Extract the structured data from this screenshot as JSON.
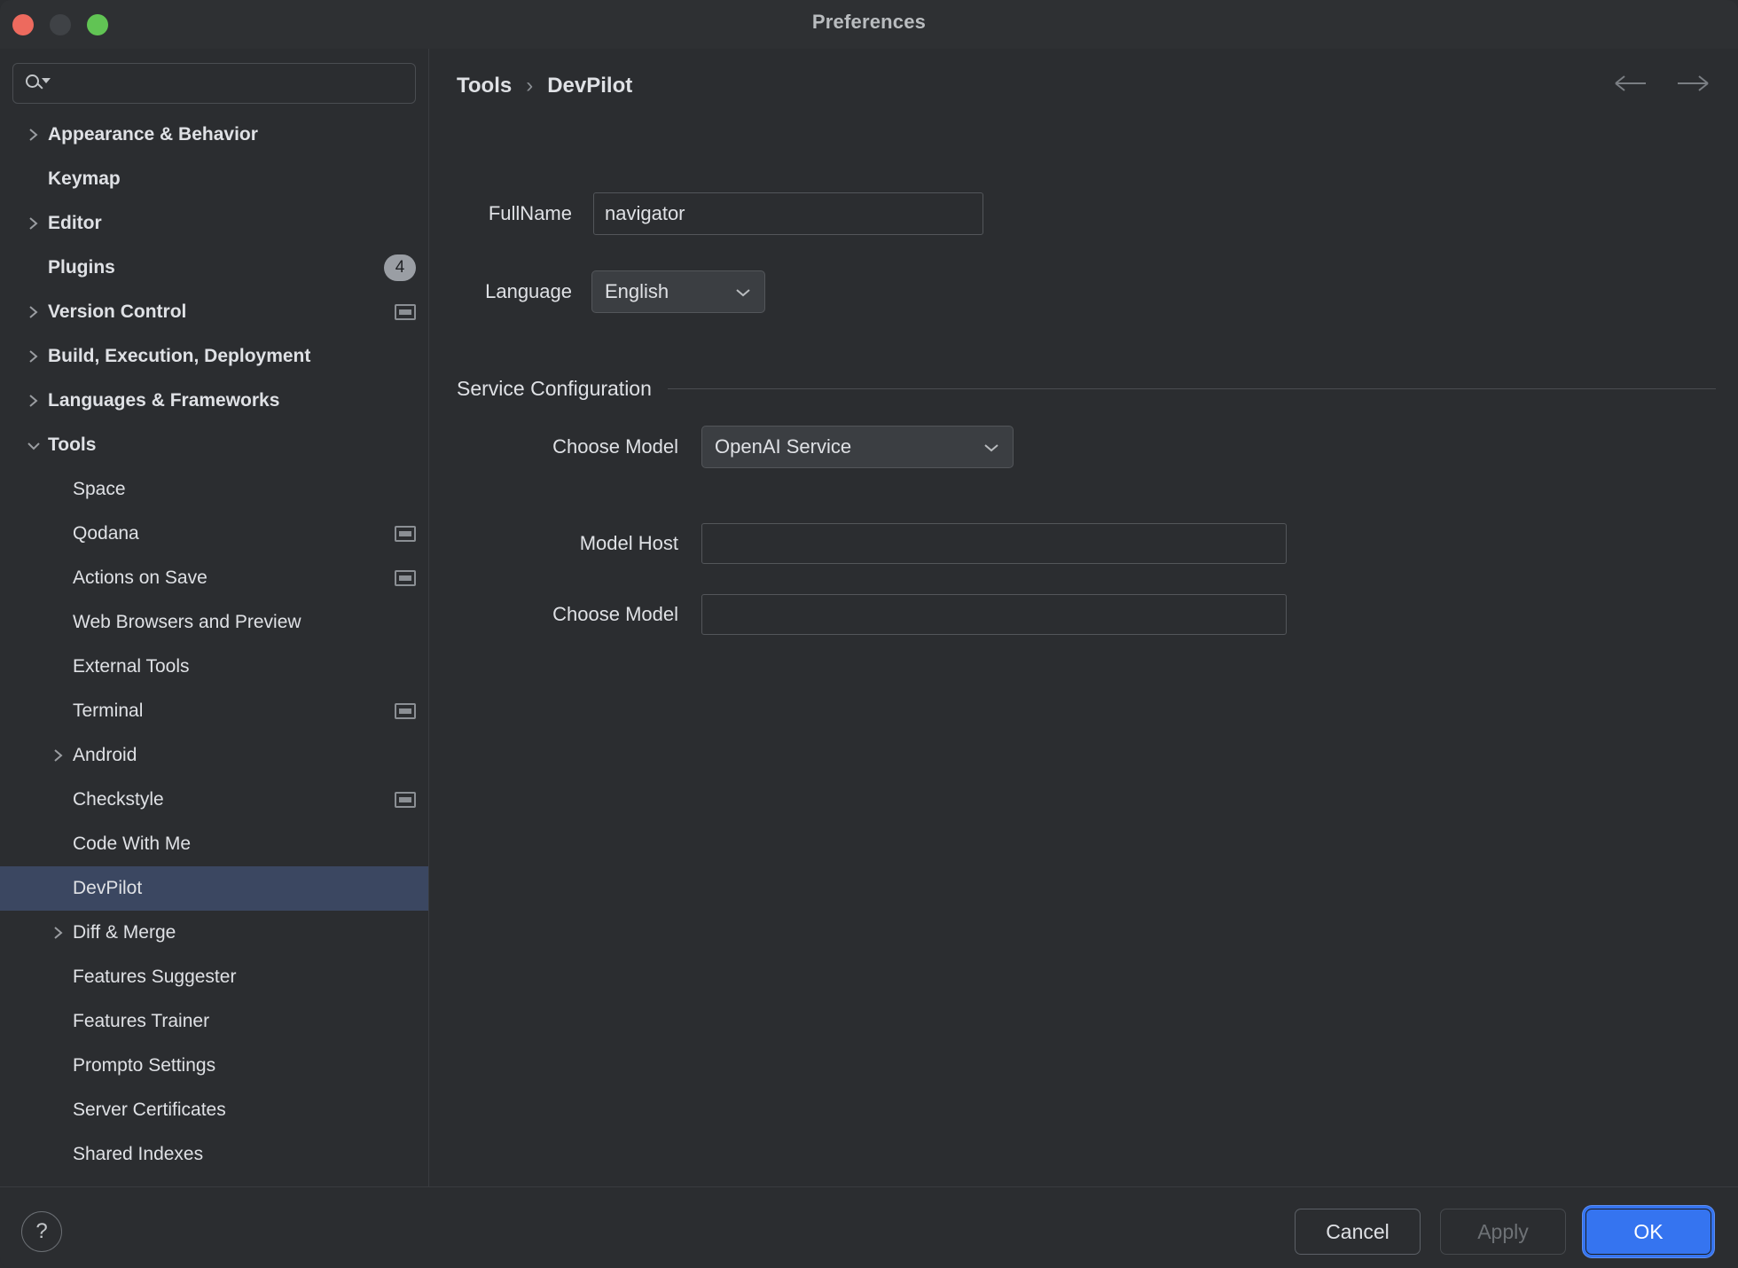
{
  "window": {
    "title": "Preferences",
    "traffic_lights": [
      "close-button",
      "minimize-button",
      "maximize-button"
    ],
    "accent_color": "#3574f0",
    "selection_color": "#3b4761"
  },
  "sidebar": {
    "search": {
      "placeholder": "",
      "value": "",
      "icon": "search-icon"
    },
    "items": [
      {
        "label": "Appearance & Behavior",
        "level": 0,
        "expandable": true,
        "expanded": false,
        "selected": false
      },
      {
        "label": "Keymap",
        "level": 0,
        "expandable": false,
        "expanded": false,
        "selected": false
      },
      {
        "label": "Editor",
        "level": 0,
        "expandable": true,
        "expanded": false,
        "selected": false
      },
      {
        "label": "Plugins",
        "level": 0,
        "expandable": false,
        "expanded": false,
        "selected": false,
        "badge": "4"
      },
      {
        "label": "Version Control",
        "level": 0,
        "expandable": true,
        "expanded": false,
        "selected": false,
        "scope_icon": true
      },
      {
        "label": "Build, Execution, Deployment",
        "level": 0,
        "expandable": true,
        "expanded": false,
        "selected": false
      },
      {
        "label": "Languages & Frameworks",
        "level": 0,
        "expandable": true,
        "expanded": false,
        "selected": false
      },
      {
        "label": "Tools",
        "level": 0,
        "expandable": true,
        "expanded": true,
        "selected": false
      },
      {
        "label": "Space",
        "level": 1,
        "expandable": false,
        "expanded": false,
        "selected": false
      },
      {
        "label": "Qodana",
        "level": 1,
        "expandable": false,
        "expanded": false,
        "selected": false,
        "scope_icon": true
      },
      {
        "label": "Actions on Save",
        "level": 1,
        "expandable": false,
        "expanded": false,
        "selected": false,
        "scope_icon": true
      },
      {
        "label": "Web Browsers and Preview",
        "level": 1,
        "expandable": false,
        "expanded": false,
        "selected": false
      },
      {
        "label": "External Tools",
        "level": 1,
        "expandable": false,
        "expanded": false,
        "selected": false
      },
      {
        "label": "Terminal",
        "level": 1,
        "expandable": false,
        "expanded": false,
        "selected": false,
        "scope_icon": true
      },
      {
        "label": "Android",
        "level": 1,
        "expandable": true,
        "expanded": false,
        "selected": false
      },
      {
        "label": "Checkstyle",
        "level": 1,
        "expandable": false,
        "expanded": false,
        "selected": false,
        "scope_icon": true
      },
      {
        "label": "Code With Me",
        "level": 1,
        "expandable": false,
        "expanded": false,
        "selected": false
      },
      {
        "label": "DevPilot",
        "level": 1,
        "expandable": false,
        "expanded": false,
        "selected": true
      },
      {
        "label": "Diff & Merge",
        "level": 1,
        "expandable": true,
        "expanded": false,
        "selected": false
      },
      {
        "label": "Features Suggester",
        "level": 1,
        "expandable": false,
        "expanded": false,
        "selected": false
      },
      {
        "label": "Features Trainer",
        "level": 1,
        "expandable": false,
        "expanded": false,
        "selected": false
      },
      {
        "label": "Prompto Settings",
        "level": 1,
        "expandable": false,
        "expanded": false,
        "selected": false
      },
      {
        "label": "Server Certificates",
        "level": 1,
        "expandable": false,
        "expanded": false,
        "selected": false
      },
      {
        "label": "Shared Indexes",
        "level": 1,
        "expandable": false,
        "expanded": false,
        "selected": false
      }
    ]
  },
  "main": {
    "breadcrumb": {
      "parent": "Tools",
      "separator": "›",
      "current": "DevPilot"
    },
    "nav": {
      "back": "back-arrow",
      "forward": "forward-arrow"
    },
    "fullname": {
      "label": "FullName",
      "value": "navigator",
      "placeholder": ""
    },
    "language": {
      "label": "Language",
      "value": "English",
      "options": [
        "English"
      ]
    },
    "service_configuration": {
      "section_title": "Service Configuration",
      "choose_model_select": {
        "label": "Choose Model",
        "value": "OpenAI Service",
        "options": [
          "OpenAI Service"
        ]
      },
      "model_host": {
        "label": "Model Host",
        "value": "",
        "placeholder": ""
      },
      "choose_model_input": {
        "label": "Choose Model",
        "value": "",
        "placeholder": ""
      }
    }
  },
  "footer": {
    "help_label": "?",
    "cancel_label": "Cancel",
    "apply_label": "Apply",
    "ok_label": "OK",
    "apply_disabled": true
  }
}
